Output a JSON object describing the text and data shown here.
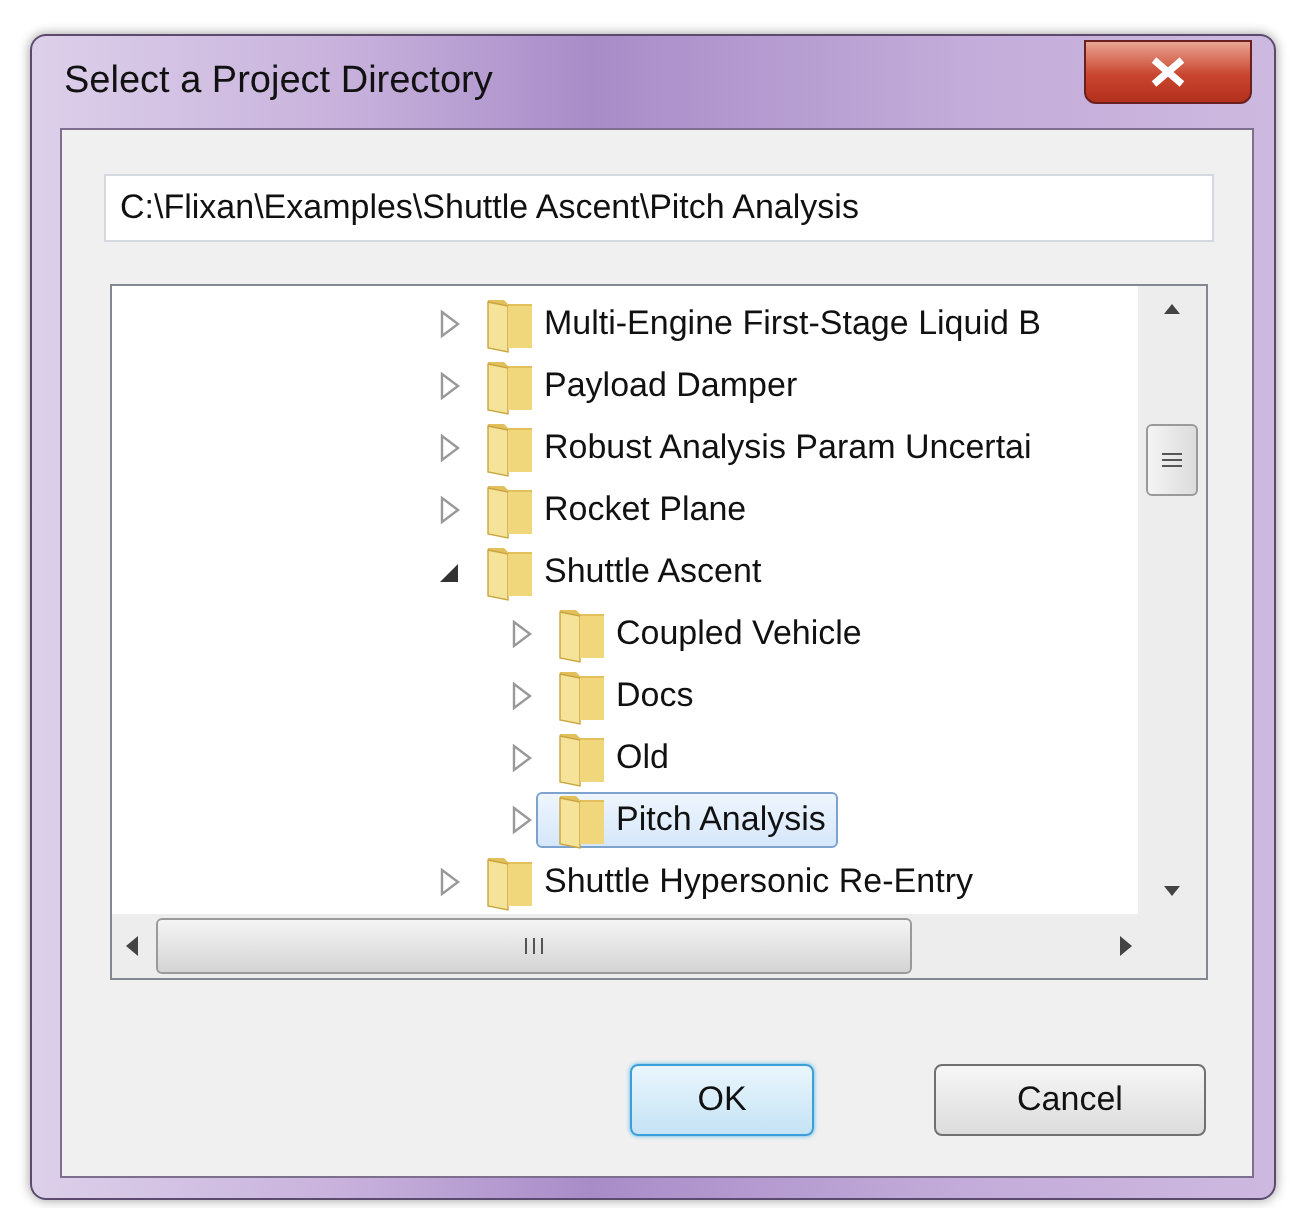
{
  "window": {
    "title": "Select a Project Directory"
  },
  "path_field": {
    "value": "C:\\Flixan\\Examples\\Shuttle Ascent\\Pitch Analysis"
  },
  "tree": [
    {
      "label": "Multi-Engine First-Stage Liquid B",
      "expanded": false,
      "selected": false
    },
    {
      "label": "Payload Damper",
      "expanded": false,
      "selected": false
    },
    {
      "label": "Robust Analysis Param Uncertai",
      "expanded": false,
      "selected": false
    },
    {
      "label": "Rocket Plane",
      "expanded": false,
      "selected": false
    },
    {
      "label": "Shuttle Ascent",
      "expanded": true,
      "selected": false,
      "children": [
        {
          "label": "Coupled Vehicle",
          "expanded": false,
          "selected": false
        },
        {
          "label": "Docs",
          "expanded": false,
          "selected": false
        },
        {
          "label": "Old",
          "expanded": false,
          "selected": false
        },
        {
          "label": "Pitch Analysis",
          "expanded": false,
          "selected": true
        }
      ]
    },
    {
      "label": "Shuttle Hypersonic Re-Entry",
      "expanded": false,
      "selected": false
    }
  ],
  "buttons": [
    {
      "label": "OK",
      "default": true
    },
    {
      "label": "Cancel",
      "default": false
    }
  ]
}
